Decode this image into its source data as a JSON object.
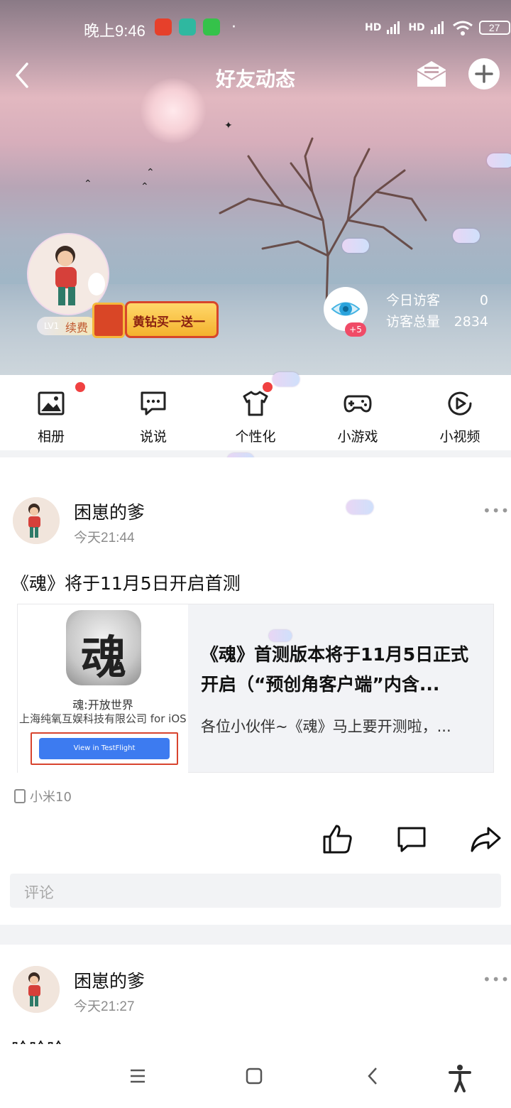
{
  "status_bar": {
    "time": "晚上9:46",
    "battery": "27",
    "signal1": "HD",
    "signal2": "HD"
  },
  "header": {
    "title": "好友动态"
  },
  "profile": {
    "level": "LV1",
    "renew_label": "续费",
    "vip_promo": "黄钻买一送一",
    "visitor_badge": "+5",
    "today_visitors_label": "今日访客",
    "today_visitors_value": "0",
    "total_visitors_label": "访客总量",
    "total_visitors_value": "2834"
  },
  "menu": {
    "items": [
      {
        "label": "相册",
        "icon": "album-icon",
        "has_dot": true
      },
      {
        "label": "说说",
        "icon": "speech-icon",
        "has_dot": false
      },
      {
        "label": "个性化",
        "icon": "shirt-icon",
        "has_dot": true
      },
      {
        "label": "小游戏",
        "icon": "gamepad-icon",
        "has_dot": false
      },
      {
        "label": "小视频",
        "icon": "video-play-icon",
        "has_dot": false
      }
    ]
  },
  "posts": [
    {
      "author": "困崽的爹",
      "time": "今天21:44",
      "text": "《魂》将于11月5日开启首测",
      "card": {
        "app_name": "魂:开放世界",
        "company": "上海纯氧互娱科技有限公司 for iOS",
        "button": "View in TestFlight",
        "title": "《魂》首测版本将于11月5日正式开启（“预创角客户端”内含...",
        "desc": "各位小伙伴~《魂》马上要开测啦，..."
      },
      "device": "小米10",
      "comment_placeholder": "评论"
    },
    {
      "author": "困崽的爹",
      "time": "今天21:27",
      "text": "哈哈哈"
    }
  ],
  "colors": {
    "red_dot": "#f04141",
    "badge_pink": "#f04b67",
    "testflight_blue": "#3d7bf0"
  }
}
